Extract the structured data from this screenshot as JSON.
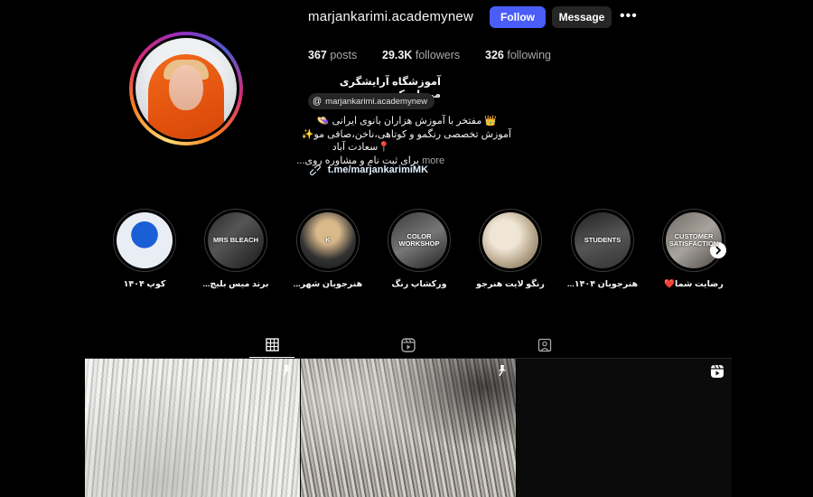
{
  "profile": {
    "username": "marjankarimi.academynew",
    "follow_label": "Follow",
    "message_label": "Message",
    "more_label": "•••",
    "stats": {
      "posts_value": "367",
      "posts_label": "posts",
      "followers_value": "29.3K",
      "followers_label": "followers",
      "following_value": "326",
      "following_label": "following"
    },
    "full_name": "آموزشگاه آرایشگری مرجان کریمی",
    "threads_handle": "marjankarimi.academynew",
    "bio": {
      "line1": "👑 مفتخر با آموزش هزاران بانوی ایرانی 👒",
      "line2": "آموزش تخصصی رنگمو و کوتاهی،ناخن،صافی مو✨",
      "line3": "📍سعادت آباد",
      "line4": "برای ثبت نام و مشاوره روی...",
      "more": "more"
    },
    "link": "t.me/marjankarimiMK"
  },
  "highlights": [
    {
      "label": "کوپ ۱۴۰۴",
      "cover_text": ""
    },
    {
      "label": "برند میس بلیچ...",
      "cover_text": "MRS BLEACH"
    },
    {
      "label": "هنرجویان شهر...",
      "cover_text": "K"
    },
    {
      "label": "ورکشاپ رنگ",
      "cover_text": "COLOR WORKSHOP"
    },
    {
      "label": "رنگو لایت هنرجو",
      "cover_text": ""
    },
    {
      "label": "هنرجویان ۱۴۰۴...",
      "cover_text": "STUDENTS"
    },
    {
      "label": "رضایت شما❤️",
      "cover_text": "CUSTOMER SATISFACTION"
    }
  ],
  "tabs": [
    {
      "name": "posts",
      "icon": "grid-icon",
      "active": true
    },
    {
      "name": "reels",
      "icon": "reels-icon",
      "active": false
    },
    {
      "name": "tagged",
      "icon": "tagged-icon",
      "active": false
    }
  ],
  "posts": [
    {
      "badge": "pin-icon"
    },
    {
      "badge": "pin-icon"
    },
    {
      "badge": "reel-icon"
    }
  ],
  "colors": {
    "accent": "#4a5df9",
    "background": "#000000",
    "secondary_button": "#262626"
  }
}
